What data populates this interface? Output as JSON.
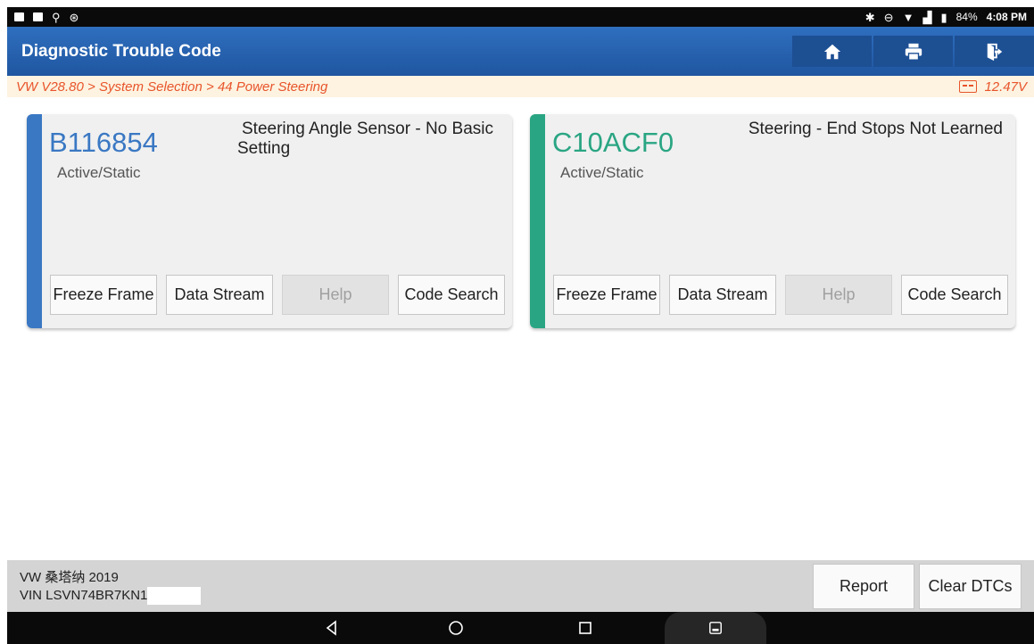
{
  "status_bar": {
    "battery": "84%",
    "time": "4:08 PM"
  },
  "header": {
    "title": "Diagnostic Trouble Code"
  },
  "breadcrumb": {
    "path": "VW V28.80 > System Selection > 44 Power Steering",
    "voltage": "12.47V"
  },
  "dtcs": [
    {
      "code": "B116854",
      "status": "Active/Static",
      "description": "Steering Angle Sensor - No Basic Setting",
      "accent": "#3a78c3"
    },
    {
      "code": "C10ACF0",
      "status": "Active/Static",
      "description": "Steering - End Stops Not Learned",
      "accent": "#2aa583"
    }
  ],
  "card_buttons": {
    "freeze": "Freeze Frame",
    "stream": "Data Stream",
    "help": "Help",
    "search": "Code Search"
  },
  "footer": {
    "vehicle": "VW 桑塔纳 2019",
    "vin": "VIN LSVN74BR7KN1",
    "report": "Report",
    "clear": "Clear DTCs"
  }
}
